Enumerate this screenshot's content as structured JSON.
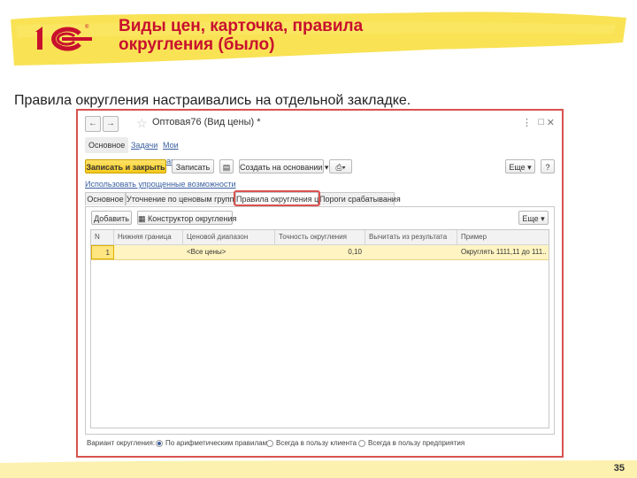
{
  "slide": {
    "title": "Виды цен, карточка, правила округления (было)",
    "subtitle": "Правила округления настраивались на отдельной закладке.",
    "page_number": "35",
    "accent_color": "#c8102e",
    "highlight_color": "#f9e04b"
  },
  "window": {
    "title": "Оптовая76 (Вид цены) *",
    "tabs_top": [
      "Основное",
      "Задачи",
      "Мои заметки"
    ],
    "toolbar": {
      "save_close": "Записать и закрыть",
      "save": "Записать",
      "create_based": "Создать на основании",
      "more": "Еще",
      "help": "?"
    },
    "link_simple": "Использовать упрощенные возможности",
    "tabs": [
      "Основное",
      "Уточнение по ценовым группам",
      "Правила округления цен",
      "Пороги срабатывания"
    ],
    "active_tab": "Правила округления цен",
    "panel_toolbar": {
      "add": "Добавить",
      "constructor": "Конструктор округления",
      "more": "Еще"
    },
    "grid": {
      "columns": [
        "N",
        "Нижняя граница",
        "Ценовой диапазон",
        "Точность округления",
        "Вычитать из результата",
        "Пример"
      ],
      "rows": [
        [
          "1",
          "",
          "<Все цены>",
          "0,10",
          "",
          "Округлять 1111,11 до 111..."
        ]
      ]
    },
    "footer": {
      "label": "Вариант округления:",
      "options": [
        "По арифметическим правилам",
        "Всегда в пользу клиента",
        "Всегда в пользу предприятия"
      ],
      "selected": "По арифметическим правилам"
    }
  }
}
